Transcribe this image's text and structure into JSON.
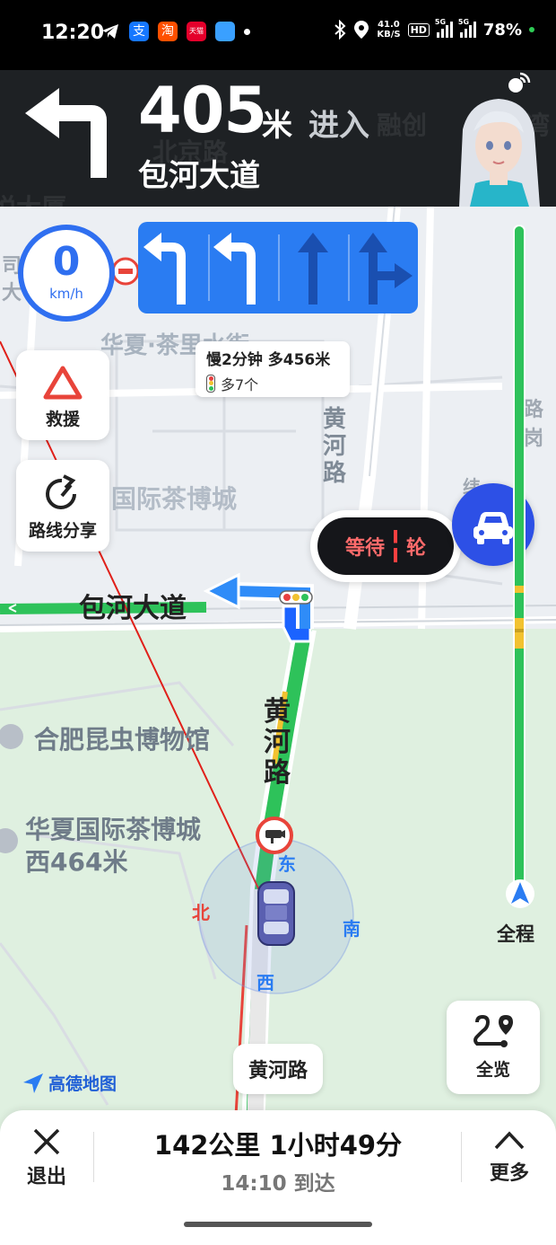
{
  "status_bar": {
    "time": "12:20",
    "net_speed_value": "41.0",
    "net_speed_unit": "KB/S",
    "hd_label": "HD",
    "signal1_label": "5G",
    "signal2_label": "5G",
    "battery": "78%",
    "app_icons": [
      "telegram-icon",
      "alipay-icon",
      "taobao-icon",
      "tmall-icon",
      "blue-app-icon"
    ],
    "tmall_label": "天猫"
  },
  "nav_header": {
    "turn_icon": "turn-left-arrow-icon",
    "distance": "405",
    "distance_unit": "米",
    "action": "进入",
    "road_name": "包河大道",
    "ghost_labels": [
      "北京路",
      "融创",
      "湾",
      "悦大厦"
    ]
  },
  "speed": {
    "value": "0",
    "unit": "km/h"
  },
  "lanes": [
    "turn-left",
    "turn-left",
    "straight",
    "straight-right"
  ],
  "traffic_tip": {
    "line1": "慢2分钟 多456米",
    "line2": "多7个"
  },
  "side_buttons": [
    {
      "label": "救援",
      "icon": "warning-triangle-icon"
    },
    {
      "label": "路线分享",
      "icon": "share-arrow-icon"
    }
  ],
  "map_labels": {
    "poi_huaxia_street": "华夏·茶里水街",
    "poi_tea_city": "国际茶博城",
    "road_baohe": "包河大道",
    "road_huanghe_top": "黄河路",
    "road_huanghe_mid": "黄河路",
    "poi_insect_museum": "合肥昆虫博物馆",
    "poi_tea_city_west": "华夏国际茶博城西464米",
    "edge_left_1": "司",
    "edge_left_2": "大",
    "edge_right_1": "路岗",
    "edge_right_2": "纬"
  },
  "wait_light": {
    "text_left": "等待",
    "text_right": "轮"
  },
  "compass": {
    "east": "东",
    "south": "南",
    "west": "西",
    "north": "北"
  },
  "overview_button": {
    "label": "全览"
  },
  "progress_label": "全程",
  "current_road": "黄河路",
  "logo_text": "高德地图",
  "bottom": {
    "exit_label": "退出",
    "distance_remaining": "142公里",
    "time_remaining": "1小时49分",
    "arrival": "14:10 到达",
    "more_label": "更多"
  },
  "colors": {
    "route_green": "#2ec25a",
    "accent_blue": "#2a7cf2",
    "car_fab_blue": "#2d50e6",
    "warning_red": "#e8443a"
  }
}
